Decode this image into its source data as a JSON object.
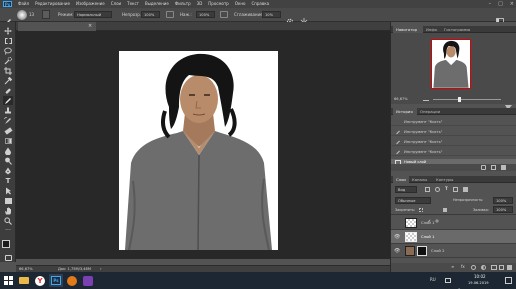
{
  "app": {
    "logo": "Ps"
  },
  "menu": [
    "Файл",
    "Редактирование",
    "Изображение",
    "Слои",
    "Текст",
    "Выделение",
    "Фильтр",
    "3D",
    "Просмотр",
    "Окно",
    "Справка"
  ],
  "options": {
    "mode_label": "Режим:",
    "mode_value": "Нормальный",
    "opacity_label": "Непрозр.:",
    "opacity_value": "100%",
    "pressure_label": "Наж.:",
    "pressure_value": "100%",
    "smoothing_label": "Сглаживание:",
    "smoothing_value": "10%",
    "brush_size": "13"
  },
  "document": {
    "tab_title": "ea13-ii81.jpg @ 66,7% (Слой 1, RGB/8)",
    "close_glyph": "×"
  },
  "status": {
    "zoom": "66,67%",
    "doc_info": "Док: 1,75М/3,46М"
  },
  "navigator": {
    "tabs": [
      "Навигатор",
      "Инфо",
      "Гистограмма"
    ],
    "zoom": "66,67%"
  },
  "history": {
    "tabs": [
      "История",
      "Операции"
    ],
    "items": [
      "Инструмент \"Кисть\"",
      "Инструмент \"Кисть\"",
      "Инструмент \"Кисть\"",
      "Инструмент \"Кисть\"",
      "Новый слой"
    ]
  },
  "layers": {
    "tabs": [
      "Слои",
      "Каналы",
      "Контуры"
    ],
    "filter_label": "Вид",
    "blend_mode": "Обычные",
    "opacity_label": "Непрозрачность:",
    "opacity_value": "100%",
    "lock_label": "Закрепить:",
    "fill_label": "Заливка:",
    "fill_value": "100%",
    "items": [
      {
        "name": "Слой 1",
        "visible": false
      },
      {
        "name": "Слой 1",
        "visible": true
      },
      {
        "name": "Слой 2",
        "visible": true
      }
    ]
  },
  "taskbar": {
    "lang": "RU",
    "time": "10:02",
    "date": "19.06.2019"
  },
  "colors": {
    "accent": "#3fa9f5",
    "foreground": "#1b1b1b",
    "background": "#6a2fc4",
    "selected": "#6a6a6a"
  }
}
